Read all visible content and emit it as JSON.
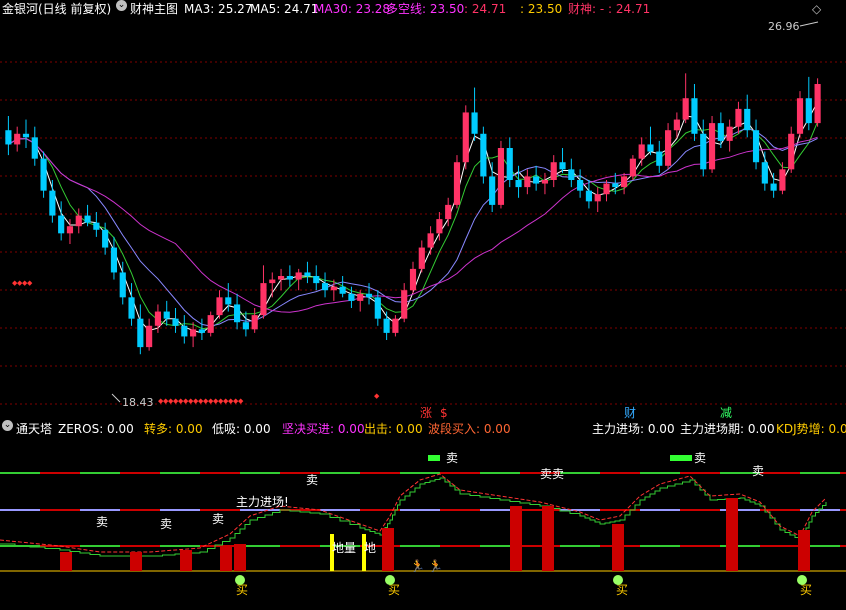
{
  "top_panel": {
    "instrument": "金银河(日线 前复权)",
    "indicator_name": "财神主图",
    "ma3_label": "MA3: 25.27",
    "ma5_label": "MA5: 24.71",
    "ma30_label": "MA30: 23.28",
    "duokong_label": "多空线: 23.50",
    "dk_extra": ": 24.71",
    "extra2": ": 23.50",
    "caishen_label": "财神: - : 24.71",
    "high_price": "26.96",
    "low_price": "18.43",
    "signals": [
      {
        "label": "涨",
        "color": "#ff3333"
      },
      {
        "label": "$",
        "color": "#ff3333"
      },
      {
        "label": "财",
        "color": "#33aaff"
      },
      {
        "label": "减",
        "color": "#33ff66"
      }
    ],
    "candles": [
      [
        25.5,
        25.9,
        24.8,
        25.1
      ],
      [
        25.1,
        25.6,
        24.9,
        25.4
      ],
      [
        25.4,
        25.8,
        25.0,
        25.3
      ],
      [
        25.3,
        25.6,
        24.5,
        24.7
      ],
      [
        24.7,
        24.9,
        23.6,
        23.8
      ],
      [
        23.8,
        24.1,
        22.9,
        23.1
      ],
      [
        23.1,
        23.5,
        22.4,
        22.6
      ],
      [
        22.6,
        23.0,
        22.3,
        22.8
      ],
      [
        22.8,
        23.3,
        22.6,
        23.1
      ],
      [
        23.1,
        23.4,
        22.8,
        22.9
      ],
      [
        22.9,
        23.2,
        22.5,
        22.7
      ],
      [
        22.7,
        22.9,
        22.0,
        22.2
      ],
      [
        22.2,
        22.5,
        21.3,
        21.5
      ],
      [
        21.5,
        21.8,
        20.6,
        20.8
      ],
      [
        20.8,
        21.2,
        20.0,
        20.2
      ],
      [
        20.2,
        20.6,
        19.2,
        19.4
      ],
      [
        19.4,
        20.2,
        19.3,
        20.0
      ],
      [
        20.0,
        20.6,
        19.8,
        20.4
      ],
      [
        20.4,
        20.7,
        20.0,
        20.2
      ],
      [
        20.2,
        20.5,
        19.8,
        20.0
      ],
      [
        20.0,
        20.3,
        19.5,
        19.7
      ],
      [
        19.7,
        20.1,
        19.4,
        19.9
      ],
      [
        19.9,
        20.2,
        19.6,
        19.8
      ],
      [
        19.8,
        20.4,
        19.7,
        20.3
      ],
      [
        20.3,
        21.0,
        20.2,
        20.8
      ],
      [
        20.8,
        21.2,
        20.4,
        20.6
      ],
      [
        20.6,
        20.9,
        19.9,
        20.1
      ],
      [
        20.1,
        20.4,
        19.7,
        19.9
      ],
      [
        19.9,
        20.5,
        19.8,
        20.3
      ],
      [
        20.3,
        21.7,
        20.2,
        21.2
      ],
      [
        21.2,
        21.5,
        20.8,
        21.3
      ],
      [
        21.3,
        21.6,
        21.0,
        21.4
      ],
      [
        21.4,
        21.7,
        21.1,
        21.3
      ],
      [
        21.3,
        21.6,
        21.0,
        21.5
      ],
      [
        21.5,
        21.8,
        21.2,
        21.4
      ],
      [
        21.4,
        21.7,
        21.0,
        21.2
      ],
      [
        21.2,
        21.5,
        20.8,
        21.0
      ],
      [
        21.0,
        21.3,
        20.7,
        21.1
      ],
      [
        21.1,
        21.4,
        20.8,
        20.9
      ],
      [
        20.9,
        21.1,
        20.5,
        20.7
      ],
      [
        20.7,
        21.0,
        20.4,
        20.9
      ],
      [
        20.9,
        21.2,
        20.6,
        20.8
      ],
      [
        20.8,
        21.0,
        20.0,
        20.2
      ],
      [
        20.2,
        20.4,
        19.6,
        19.8
      ],
      [
        19.8,
        20.3,
        19.7,
        20.2
      ],
      [
        20.2,
        21.2,
        20.1,
        21.0
      ],
      [
        21.0,
        21.8,
        20.9,
        21.6
      ],
      [
        21.6,
        22.4,
        21.5,
        22.2
      ],
      [
        22.2,
        22.8,
        22.0,
        22.6
      ],
      [
        22.6,
        23.2,
        22.4,
        23.0
      ],
      [
        23.0,
        23.6,
        22.8,
        23.4
      ],
      [
        23.4,
        24.8,
        23.3,
        24.6
      ],
      [
        24.6,
        26.2,
        24.4,
        26.0
      ],
      [
        26.0,
        26.7,
        25.2,
        25.4
      ],
      [
        25.4,
        25.6,
        24.0,
        24.2
      ],
      [
        24.2,
        24.6,
        23.2,
        23.4
      ],
      [
        23.4,
        25.2,
        23.3,
        25.0
      ],
      [
        25.0,
        25.3,
        23.9,
        24.1
      ],
      [
        24.1,
        24.5,
        23.6,
        23.9
      ],
      [
        23.9,
        24.4,
        23.7,
        24.2
      ],
      [
        24.2,
        24.5,
        23.8,
        24.0
      ],
      [
        24.0,
        24.3,
        23.7,
        24.1
      ],
      [
        24.1,
        24.8,
        23.9,
        24.6
      ],
      [
        24.6,
        25.0,
        24.3,
        24.4
      ],
      [
        24.4,
        24.7,
        23.9,
        24.1
      ],
      [
        24.1,
        24.4,
        23.6,
        23.8
      ],
      [
        23.8,
        24.1,
        23.3,
        23.5
      ],
      [
        23.5,
        23.9,
        23.2,
        23.7
      ],
      [
        23.7,
        24.1,
        23.5,
        24.0
      ],
      [
        24.0,
        24.3,
        23.7,
        23.9
      ],
      [
        23.9,
        24.3,
        23.7,
        24.2
      ],
      [
        24.2,
        24.8,
        24.1,
        24.7
      ],
      [
        24.7,
        25.3,
        24.5,
        25.1
      ],
      [
        25.1,
        25.6,
        24.8,
        24.9
      ],
      [
        24.9,
        25.2,
        24.3,
        24.5
      ],
      [
        24.5,
        25.7,
        24.4,
        25.5
      ],
      [
        25.5,
        26.0,
        25.3,
        25.8
      ],
      [
        25.8,
        27.1,
        25.7,
        26.4
      ],
      [
        26.4,
        26.8,
        25.2,
        25.4
      ],
      [
        25.4,
        25.8,
        24.2,
        24.4
      ],
      [
        24.4,
        25.9,
        24.3,
        25.7
      ],
      [
        25.7,
        26.0,
        25.0,
        25.2
      ],
      [
        25.2,
        25.8,
        24.9,
        25.6
      ],
      [
        25.6,
        26.3,
        25.4,
        26.1
      ],
      [
        26.1,
        26.5,
        25.3,
        25.5
      ],
      [
        25.5,
        25.8,
        24.4,
        24.6
      ],
      [
        24.6,
        24.9,
        23.8,
        24.0
      ],
      [
        24.0,
        24.3,
        23.6,
        23.8
      ],
      [
        23.8,
        24.6,
        23.7,
        24.4
      ],
      [
        24.4,
        25.6,
        24.3,
        25.4
      ],
      [
        25.4,
        26.6,
        25.3,
        26.4
      ],
      [
        26.4,
        27.0,
        25.5,
        25.7
      ],
      [
        25.7,
        26.96,
        25.6,
        26.8
      ]
    ]
  },
  "bottom_panel": {
    "indicator_name": "通天塔",
    "zeros": "ZEROS: 0.00",
    "zhuanduo": "转多: 0.00",
    "dixi": "低吸: 0.00",
    "jianjue": "坚决买进: 0.00",
    "chuji": "出击: 0.00",
    "boduan": "波段买入: 0.00",
    "zhuli": "主力进场: 0.00",
    "zhuli_qi": "主力进场期: 0.00",
    "kdj": "KDJ势增: 0.00",
    "sell_label": "卖",
    "sell_sell_label": "卖卖",
    "buy_label": "买",
    "zhuli_label": "主力进场!",
    "dibi_label": "地量",
    "dibi2_label": "地"
  },
  "colors": {
    "up": "#ff3366",
    "down": "#00ccff",
    "ma_blue": "#8888ff",
    "ma_purple": "#cc33cc",
    "ma_white": "#ffffff",
    "ma_green": "#33cc33",
    "grid": "#800000"
  }
}
